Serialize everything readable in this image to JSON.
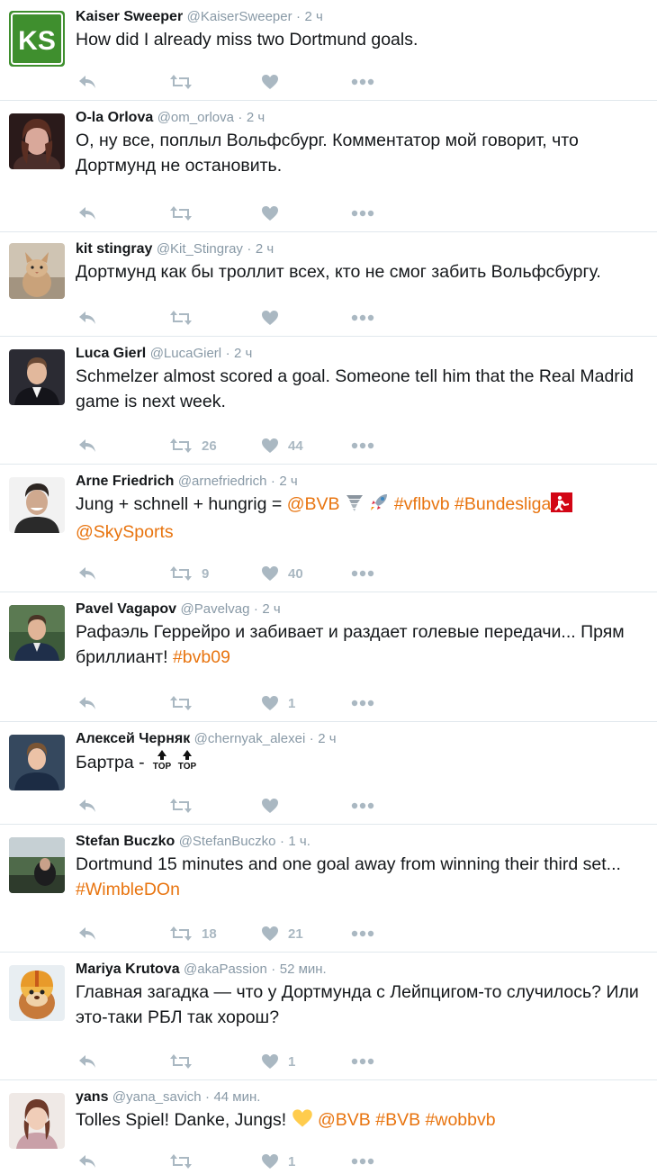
{
  "tweets": [
    {
      "name": "Kaiser Sweeper",
      "handle": "@KaiserSweeper",
      "time": "2 ч",
      "avatar": "ks-logo-avatar",
      "avatar_text": "KS",
      "text1": "How did I already miss two Dortmund goals.",
      "retweets": "",
      "likes": ""
    },
    {
      "name": "O-la Orlova",
      "handle": "@om_orlova",
      "time": "2 ч",
      "avatar": "woman-photo-avatar",
      "text1": "О, ну все, поплыл Вольфсбург. Комментатор мой говорит, что",
      "text2": "Дортмунд не остановить.",
      "retweets": "",
      "likes": ""
    },
    {
      "name": "kit stingray",
      "handle": "@Kit_Stingray",
      "time": "2 ч",
      "avatar": "cat-photo-avatar",
      "text1": "Дортмунд как бы троллит всех, кто не смог забить Вольфсбургу.",
      "retweets": "",
      "likes": ""
    },
    {
      "name": "Luca Gierl",
      "handle": "@LucaGierl",
      "time": "2 ч",
      "avatar": "man-suit-photo-avatar",
      "text1": "Schmelzer almost scored a goal. Someone tell him that the Real Madrid",
      "text2": "game is next week.",
      "retweets": "26",
      "likes": "44"
    },
    {
      "name": "Arne Friedrich",
      "handle": "@arnefriedrich",
      "time": "2 ч",
      "avatar": "man-smiling-photo-avatar",
      "text1": "Jung + schnell + hungrig = ",
      "mention1": "@BVB",
      "tag1": "#vflbvb",
      "tag2": "#Bundesliga",
      "mention2": "@SkySports",
      "retweets": "9",
      "likes": "40"
    },
    {
      "name": "Pavel Vagapov",
      "handle": "@Pavelvag",
      "time": "2 ч",
      "avatar": "man-green-photo-avatar",
      "text1": "Рафаэль Геррейро и забивает и раздает голевые передачи... Прям",
      "text2": "бриллиант! ",
      "tag1": "#bvb09",
      "retweets": "",
      "likes": "1"
    },
    {
      "name": "Алексей Черняк",
      "handle": "@chernyak_alexei",
      "time": "2 ч",
      "avatar": "young-man-photo-avatar",
      "text1": "Бартра - ",
      "top_label": "TOP",
      "retweets": "",
      "likes": ""
    },
    {
      "name": "Stefan Buczko",
      "handle": "@StefanBuczko",
      "time": "1 ч.",
      "avatar": "stadium-photo-avatar",
      "text1": "Dortmund 15 minutes and one goal away from winning their third set...",
      "tag1": "#WimbleDOn",
      "retweets": "18",
      "likes": "21"
    },
    {
      "name": "Mariya Krutova",
      "handle": "@akaPassion",
      "time": "52 мин.",
      "avatar": "cartoon-bear-avatar",
      "text1": "Главная загадка — что у Дортмунда с Лейпцигом-то случилось? Или",
      "text2": "это-таки РБЛ так хорош?",
      "retweets": "",
      "likes": "1"
    },
    {
      "name": "yans",
      "handle": "@yana_savich",
      "time": "44 мин.",
      "avatar": "girl-photo-avatar",
      "text1": "Tolles Spiel! Danke, Jungs! ",
      "mention1": "@BVB",
      "tag1": "#BVB",
      "tag2": "#wobbvb",
      "retweets": "",
      "likes": "1"
    }
  ],
  "colors": {
    "link": "#e8740f",
    "muted": "#8899a6",
    "icon": "#aab8c2",
    "divider": "#e1e8ed",
    "heart_emoji": "#ffcc4d"
  },
  "icons": [
    "reply-icon",
    "retweet-icon",
    "like-icon",
    "more-icon"
  ]
}
